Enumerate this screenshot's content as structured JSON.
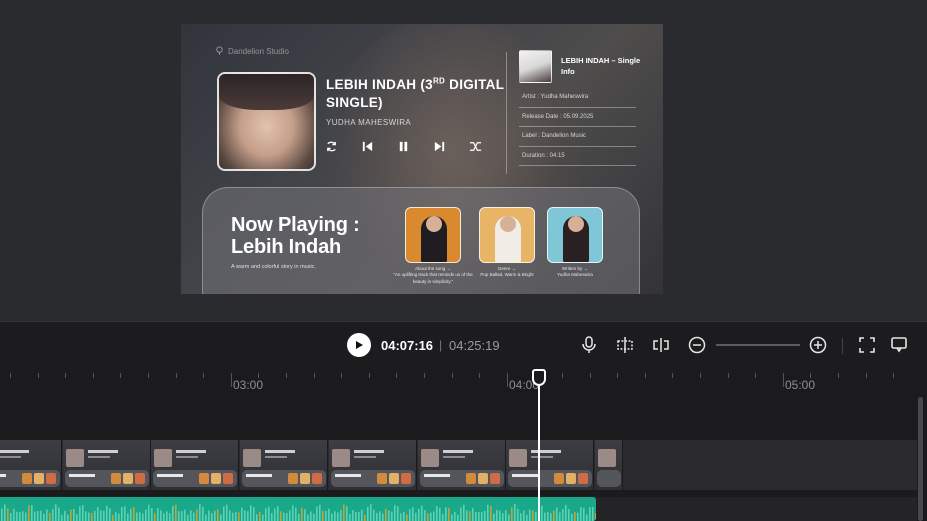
{
  "preview": {
    "studio": "Dandelion Studio",
    "song_title": "LEBIH INDAH (3",
    "song_title_sup": "RD",
    "song_title_end": " DIGITAL SINGLE)",
    "artist": "YUDHA MAHESWIRA",
    "info_title": "LEBIH INDAH – Single Info",
    "info_rows": [
      "Artist : Yudha Maheswira",
      "Release Date : 05.09.2025",
      "Label : Dandelion Music",
      "Duration : 04:15"
    ],
    "now_playing": "Now Playing : Lebih Indah",
    "now_playing_sub": "A warm and colorful story in music.",
    "cards": [
      {
        "caption": "About the song →",
        "caption2": "\"An uplifting track that reminds us of the beauty in simplicity.\"",
        "color": "#d9892e"
      },
      {
        "caption": "Genre →",
        "caption2": "Pop Ballad, Warm & Bright",
        "color": "#e7b565"
      },
      {
        "caption": "Written by →",
        "caption2": "Yudha Maheswira",
        "color": "#7fc6d6"
      }
    ]
  },
  "toolbar": {
    "current_time": "04:07:16",
    "separator": "|",
    "total_time": "04:25:19",
    "zoom_level": 0.0
  },
  "timeline": {
    "ruler_labels": [
      "03:00",
      "04:00",
      "05:00"
    ]
  }
}
